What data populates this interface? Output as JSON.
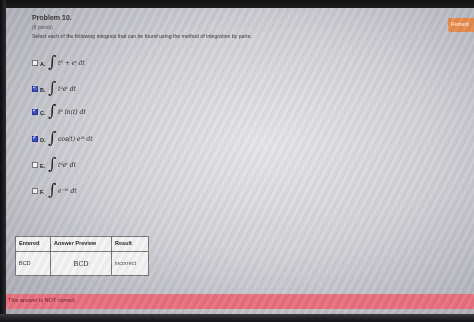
{
  "problem": {
    "title": "Problem 10.",
    "points": "(8 points)",
    "instruction": "Select each of the following integrals that can be found using the method of integration by parts."
  },
  "badge": {
    "label": "Remaini"
  },
  "options": [
    {
      "letter": "A.",
      "integral": "∫",
      "expr": "t² + eᵗ dt",
      "checked": false
    },
    {
      "letter": "B.",
      "integral": "∫",
      "expr": "t²eᵗ dt",
      "checked": true
    },
    {
      "letter": "C.",
      "integral": "∫",
      "expr": "t² ln(t) dt",
      "checked": true
    },
    {
      "letter": "D.",
      "integral": "∫",
      "expr": "cos(t) e²ᵗ dt",
      "checked": true
    },
    {
      "letter": "E.",
      "integral": "∫",
      "expr": "t³eᵗ dt",
      "checked": false
    },
    {
      "letter": "F.",
      "integral": "∫",
      "expr": "e⁻ᵗ² dt",
      "checked": false
    }
  ],
  "results": {
    "headers": [
      "Entered",
      "Answer Preview",
      "Result"
    ],
    "row": {
      "entered": "BCD",
      "preview": "BCD",
      "result": "incorrect"
    }
  },
  "status": {
    "message": "This answer is NOT correct."
  },
  "colors": {
    "checkbox_checked": "#3b4fc4",
    "status_bar": "#e8707e",
    "badge": "#e58a4c"
  }
}
